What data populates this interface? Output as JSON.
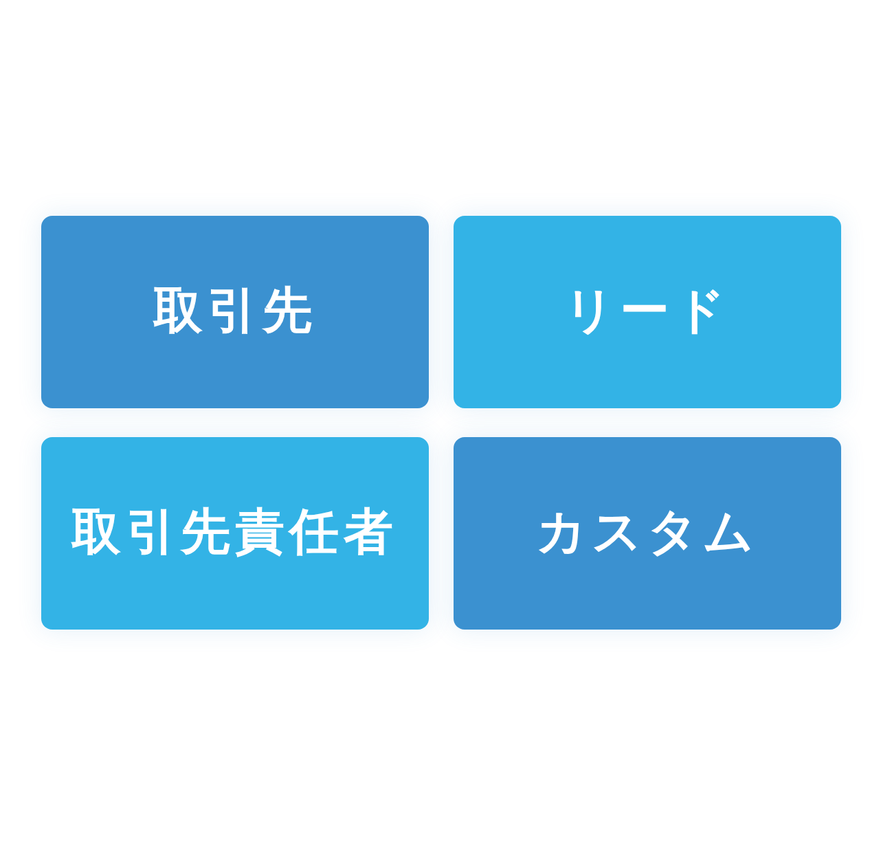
{
  "tiles": [
    {
      "label": "取引先",
      "color": "#3b91d0"
    },
    {
      "label": "リード",
      "color": "#33b3e6"
    },
    {
      "label": "取引先責任者",
      "color": "#33b3e6"
    },
    {
      "label": "カスタム",
      "color": "#3b91d0"
    }
  ]
}
